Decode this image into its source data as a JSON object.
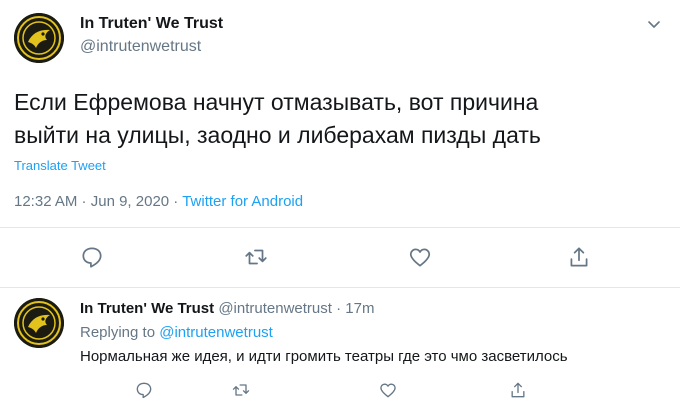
{
  "tweet": {
    "author_name": "In Truten' We Trust",
    "author_handle": "@intrutenwetrust",
    "text_line1": "Если Ефремова начнут отмазывать, вот причина",
    "text_line2": "выйти на улицы, заодно и либерахам пизды дать",
    "translate_label": "Translate Tweet",
    "time": "12:32 AM",
    "date": "Jun 9, 2020",
    "separator": " · ",
    "source": "Twitter for Android"
  },
  "reply": {
    "author_name": "In Truten' We Trust",
    "author_handle": "@intrutenwetrust",
    "separator": " · ",
    "age": "17m",
    "replying_to_label": "Replying to",
    "replying_to_handle": "@intrutenwetrust",
    "text": "Нормальная же идея, и идти громить театры где это чмо засветилось"
  },
  "icons": {
    "caret": "chevron-down-icon",
    "reply": "comment-icon",
    "retweet": "retweet-icon",
    "like": "heart-icon",
    "share": "share-icon"
  },
  "colors": {
    "link": "#1da1f2",
    "secondary": "#657786",
    "divider": "#e1e8ed",
    "icon": "#657786"
  }
}
